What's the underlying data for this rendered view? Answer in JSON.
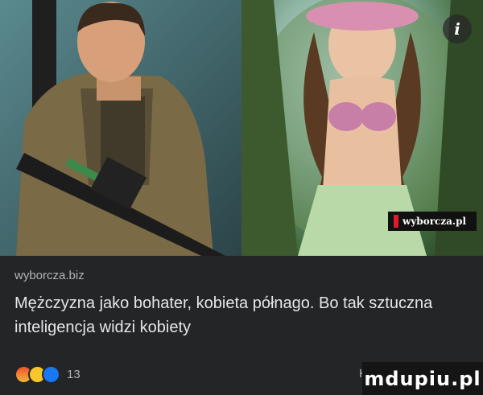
{
  "post": {
    "source": "wyborcza.biz",
    "headline": "Mężczyzna jako bohater, kobieta półnago. Bo tak sztuczna inteligencja widzi kobiety",
    "image_watermark": "wyborcza.pl",
    "info_icon_glyph": "i"
  },
  "footer": {
    "reaction_icons": [
      "angry-icon",
      "haha-icon",
      "like-icon"
    ],
    "reaction_count": "13",
    "comments_label_partial": "Ko",
    "site_watermark": "mdupiu.pl"
  },
  "colors": {
    "background": "#242526",
    "text_primary": "#e4e6eb",
    "text_secondary": "#b0b3b8",
    "like_blue": "#1877f2",
    "watermark_red": "#e0192b"
  }
}
